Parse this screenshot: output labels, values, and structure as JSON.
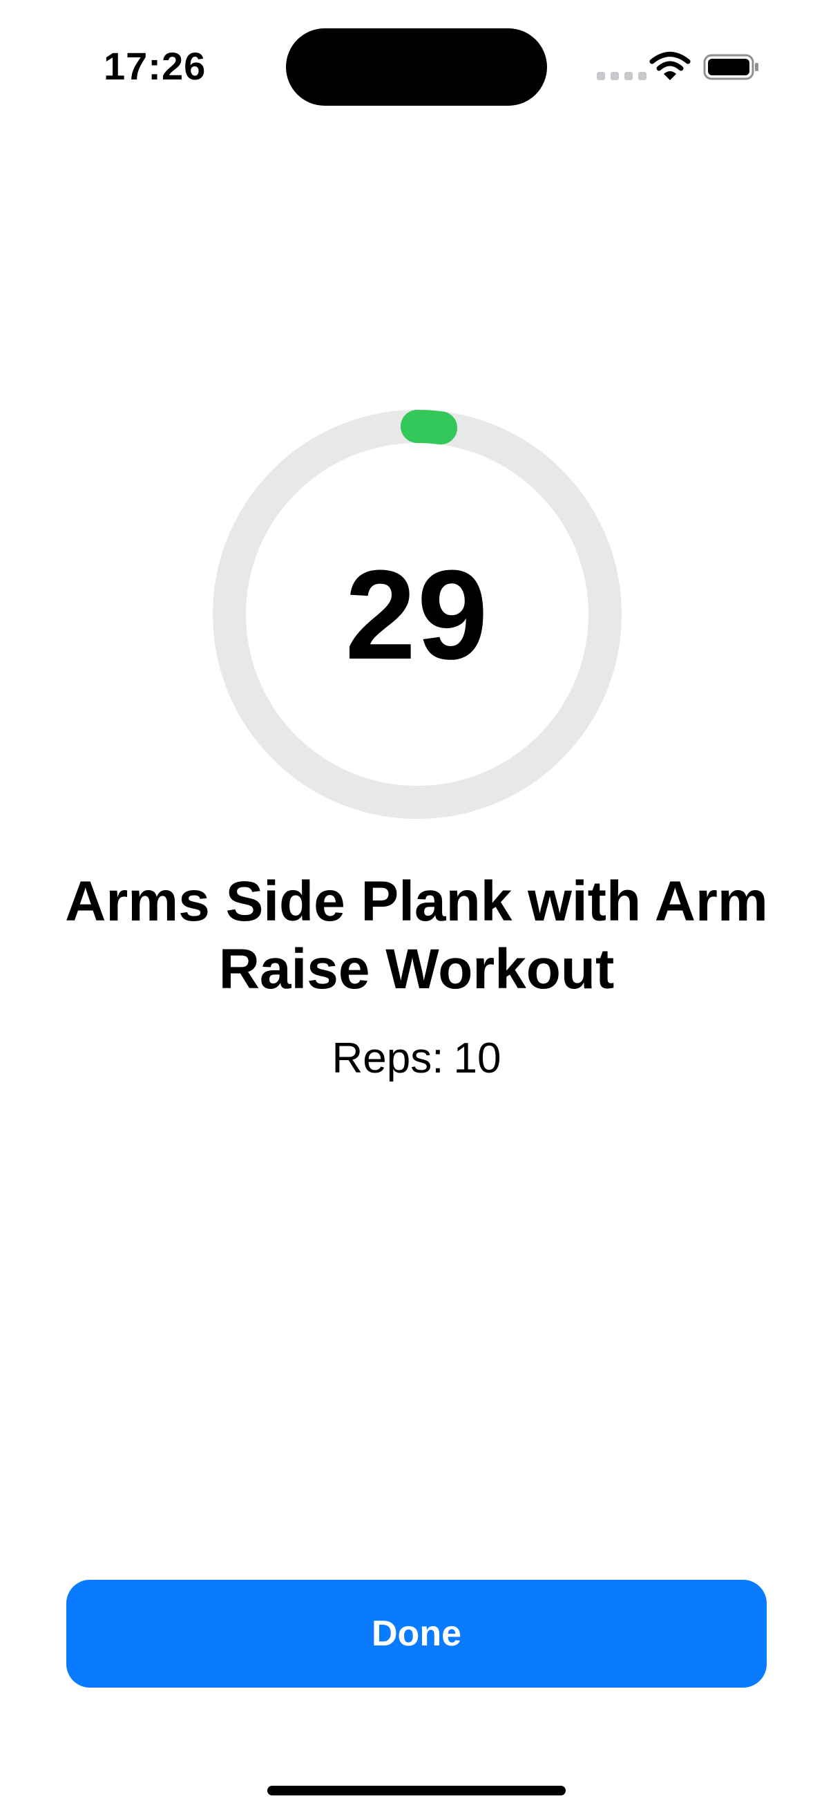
{
  "status_bar": {
    "time": "17:26",
    "icons": [
      "cellular-signal-icon",
      "wifi-icon",
      "battery-icon"
    ]
  },
  "timer": {
    "seconds_remaining": "29",
    "progress_fraction": 0.02,
    "track_color": "#e8e8e8",
    "progress_color": "#34c759"
  },
  "workout": {
    "title": "Arms Side Plank with Arm Raise Workout",
    "reps_label": "Reps:",
    "reps_value": "10"
  },
  "actions": {
    "done_label": "Done",
    "done_color": "#0a7bff"
  }
}
